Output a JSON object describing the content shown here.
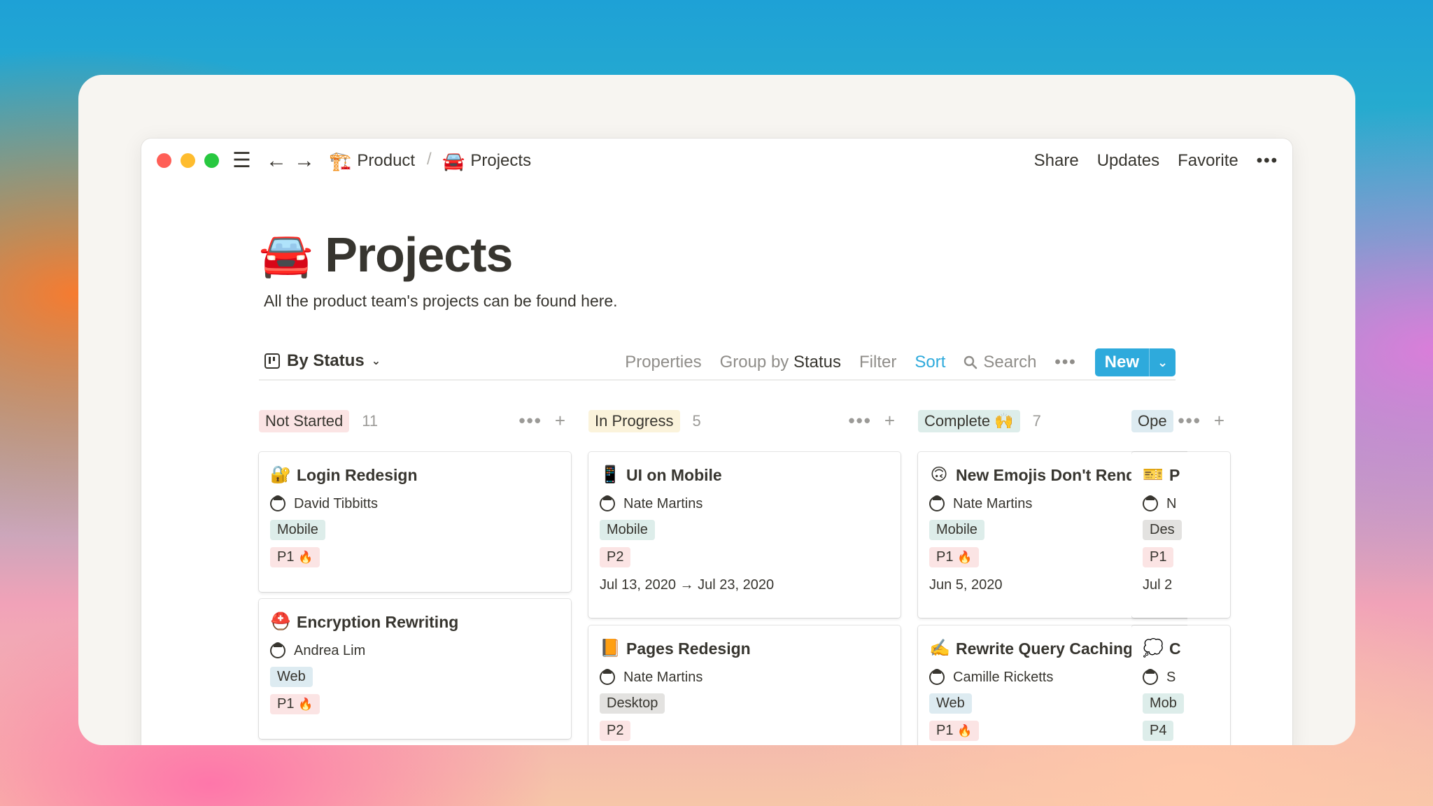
{
  "breadcrumb": [
    {
      "icon": "🏗️",
      "label": "Product"
    },
    {
      "icon": "🚘",
      "label": "Projects"
    }
  ],
  "breadcrumb_sep": "/",
  "top_actions": {
    "share": "Share",
    "updates": "Updates",
    "favorite": "Favorite",
    "more": "•••"
  },
  "page": {
    "icon": "🚘",
    "title": "Projects",
    "description": "All the product team's projects can be found here."
  },
  "toolbar": {
    "view_label": "By Status",
    "properties": "Properties",
    "group_by_prefix": "Group by",
    "group_by_value": "Status",
    "filter": "Filter",
    "sort": "Sort",
    "search": "Search",
    "more": "•••",
    "new_label": "New"
  },
  "columns": [
    {
      "name": "Not Started",
      "count": "11",
      "cards": [
        {
          "icon": "🔐",
          "title": "Login Redesign",
          "person": "David Tibbitts",
          "platform": "Mobile",
          "priority": "P1",
          "priority_icon": "🔥",
          "date": ""
        },
        {
          "icon": "⛑️",
          "title": "Encryption Rewriting",
          "person": "Andrea Lim",
          "platform": "Web",
          "priority": "P1",
          "priority_icon": "🔥",
          "date": ""
        }
      ]
    },
    {
      "name": "In Progress",
      "count": "5",
      "cards": [
        {
          "icon": "📱",
          "title": "UI on Mobile",
          "person": "Nate Martins",
          "platform": "Mobile",
          "priority": "P2",
          "priority_icon": "",
          "date": "Jul 13, 2020 → Jul 23, 2020"
        },
        {
          "icon": "📙",
          "title": "Pages Redesign",
          "person": "Nate Martins",
          "platform": "Desktop",
          "priority": "P2",
          "priority_icon": "",
          "date": ""
        }
      ]
    },
    {
      "name": "Complete 🙌",
      "count": "7",
      "cards": [
        {
          "icon": "🙃",
          "title": "New Emojis Don't Render",
          "person": "Nate Martins",
          "platform": "Mobile",
          "priority": "P1",
          "priority_icon": "🔥",
          "date": "Jun 5, 2020"
        },
        {
          "icon": "✍️",
          "title": "Rewrite Query Caching Logic",
          "person": "Camille Ricketts",
          "platform": "Web",
          "priority": "P1",
          "priority_icon": "🔥",
          "date": ""
        }
      ]
    }
  ],
  "partial_column": {
    "name": "Ope",
    "cards": [
      {
        "icon": "🎫",
        "title": "P",
        "person": "N",
        "platform": "Des",
        "priority": "P1",
        "date": "Jul 2"
      },
      {
        "icon": "💭",
        "title": "C",
        "person": "S",
        "platform": "Mob",
        "priority": "P4"
      }
    ]
  },
  "colors": {
    "accent": "#2eaadc",
    "text": "#37352f",
    "muted": "#9b9a97"
  }
}
